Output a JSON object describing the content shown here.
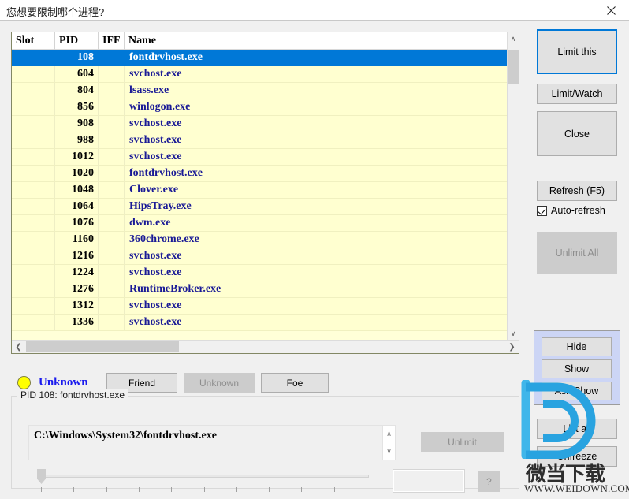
{
  "window": {
    "title": "您想要限制哪个进程?",
    "close_icon": "close-icon"
  },
  "process_list": {
    "columns": [
      "Slot",
      "PID",
      "IFF",
      "Name"
    ],
    "rows": [
      {
        "slot": "",
        "pid": "108",
        "iff": "",
        "name": "fontdrvhost.exe",
        "selected": true
      },
      {
        "slot": "",
        "pid": "604",
        "iff": "",
        "name": "svchost.exe",
        "selected": false
      },
      {
        "slot": "",
        "pid": "804",
        "iff": "",
        "name": "lsass.exe",
        "selected": false
      },
      {
        "slot": "",
        "pid": "856",
        "iff": "",
        "name": "winlogon.exe",
        "selected": false
      },
      {
        "slot": "",
        "pid": "908",
        "iff": "",
        "name": "svchost.exe",
        "selected": false
      },
      {
        "slot": "",
        "pid": "988",
        "iff": "",
        "name": "svchost.exe",
        "selected": false
      },
      {
        "slot": "",
        "pid": "1012",
        "iff": "",
        "name": "svchost.exe",
        "selected": false
      },
      {
        "slot": "",
        "pid": "1020",
        "iff": "",
        "name": "fontdrvhost.exe",
        "selected": false
      },
      {
        "slot": "",
        "pid": "1048",
        "iff": "",
        "name": "Clover.exe",
        "selected": false
      },
      {
        "slot": "",
        "pid": "1064",
        "iff": "",
        "name": "HipsTray.exe",
        "selected": false
      },
      {
        "slot": "",
        "pid": "1076",
        "iff": "",
        "name": "dwm.exe",
        "selected": false
      },
      {
        "slot": "",
        "pid": "1160",
        "iff": "",
        "name": "360chrome.exe",
        "selected": false
      },
      {
        "slot": "",
        "pid": "1216",
        "iff": "",
        "name": "svchost.exe",
        "selected": false
      },
      {
        "slot": "",
        "pid": "1224",
        "iff": "",
        "name": "svchost.exe",
        "selected": false
      },
      {
        "slot": "",
        "pid": "1276",
        "iff": "",
        "name": "RuntimeBroker.exe",
        "selected": false
      },
      {
        "slot": "",
        "pid": "1312",
        "iff": "",
        "name": "svchost.exe",
        "selected": false
      },
      {
        "slot": "",
        "pid": "1336",
        "iff": "",
        "name": "svchost.exe",
        "selected": false
      }
    ],
    "scroll": {
      "up_arrow": "∧",
      "down_arrow": "∨",
      "left_arrow": "❮",
      "right_arrow": "❯"
    },
    "selected_row_color": "#0078d7",
    "row_background_color": "#ffffd0",
    "name_text_color": "#1a1a96"
  },
  "classification": {
    "indicator_color": "#ffff00",
    "status_label": "Unknown",
    "status_label_color": "#1a1aee",
    "buttons": [
      {
        "label": "Friend",
        "disabled": false
      },
      {
        "label": "Unknown",
        "disabled": true
      },
      {
        "label": "Foe",
        "disabled": false
      }
    ]
  },
  "details": {
    "caption": "PID 108: fontdrvhost.exe",
    "path": "C:\\Windows\\System32\\fontdrvhost.exe",
    "unlimit_label": "Unlimit",
    "unlimit_disabled": true,
    "value_input": "",
    "help_label": "?",
    "slider": {
      "value": 0,
      "min": 0,
      "max": 100,
      "tick_count": 11
    },
    "scroll": {
      "up_arrow": "∧",
      "down_arrow": "∨"
    }
  },
  "right_panel": {
    "limit_this": "Limit this",
    "limit_watch": "Limit/Watch",
    "close": "Close",
    "refresh": "Refresh (F5)",
    "auto_refresh_label": "Auto-refresh",
    "auto_refresh_checked": true,
    "unlimit_all": "Unlimit All",
    "unlimit_all_disabled": true,
    "visibility_group": {
      "hide": "Hide",
      "show": "Show",
      "ask_show": "Ask/Show",
      "background_color": "#ccd5f5"
    },
    "list_all": "List all",
    "unfreeze": "Unfreeze",
    "focus_color": "#0078d7"
  },
  "watermark": {
    "logo_color": "#29a3e0",
    "brand_cn": "微当下载",
    "url": "WWW.WEIDOWN.COM"
  }
}
